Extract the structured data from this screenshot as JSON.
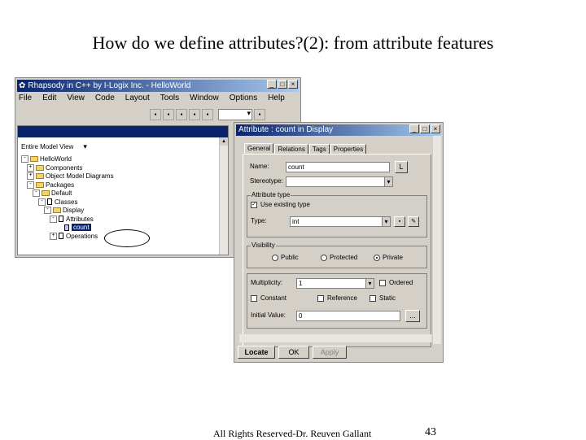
{
  "slide": {
    "title": "How do we define attributes?(2): from attribute features",
    "footer": "All Rights Reserved-Dr. Reuven Gallant",
    "page": "43"
  },
  "app": {
    "title": "Rhapsody in C++ by I-Logix Inc. - HelloWorld",
    "window_buttons": [
      "_",
      "□",
      "×"
    ],
    "menu": [
      "File",
      "Edit",
      "View",
      "Code",
      "Layout",
      "Tools",
      "Window",
      "Options",
      "Help"
    ],
    "browser": {
      "filter": "Entire Model View",
      "tree": [
        {
          "label": "HelloWorld",
          "depth": 0,
          "kind": "folder",
          "expander": "-"
        },
        {
          "label": "Components",
          "depth": 1,
          "kind": "folder",
          "expander": "+"
        },
        {
          "label": "Object Model Diagrams",
          "depth": 1,
          "kind": "folder",
          "expander": "+"
        },
        {
          "label": "Packages",
          "depth": 1,
          "kind": "folder",
          "expander": "-"
        },
        {
          "label": "Default",
          "depth": 2,
          "kind": "folder",
          "expander": "-"
        },
        {
          "label": "Classes",
          "depth": 3,
          "kind": "class",
          "expander": "-"
        },
        {
          "label": "Display",
          "depth": 4,
          "kind": "folder",
          "expander": "-"
        },
        {
          "label": "Attributes",
          "depth": 5,
          "kind": "class",
          "expander": "-"
        },
        {
          "label": "count",
          "depth": 6,
          "kind": "attr",
          "expander": "",
          "selected": true
        },
        {
          "label": "Operations",
          "depth": 5,
          "kind": "class",
          "expander": "+"
        }
      ]
    }
  },
  "dialog": {
    "title": "Attribute : count in Display",
    "tabs": [
      "General",
      "Relations",
      "Tags",
      "Properties"
    ],
    "name_label": "Name:",
    "name_value": "count",
    "name_button": "L",
    "stereotype_label": "Stereotype:",
    "attr_type_group": "Attribute type",
    "use_existing_label": "Use existing type",
    "type_label": "Type:",
    "type_value": "int",
    "visibility_group": "Visibility",
    "visibility_options": [
      "Public",
      "Protected",
      "Private"
    ],
    "visibility_selected": "Private",
    "multiplicity_label": "Multiplicity:",
    "multiplicity_value": "1",
    "ordered_label": "Ordered",
    "constant_label": "Constant",
    "reference_label": "Reference",
    "static_label": "Static",
    "initial_label": "Initial Value:",
    "initial_value": "0",
    "browse_button": "...",
    "buttons": {
      "locate": "Locate",
      "ok": "OK",
      "apply": "Apply"
    }
  }
}
